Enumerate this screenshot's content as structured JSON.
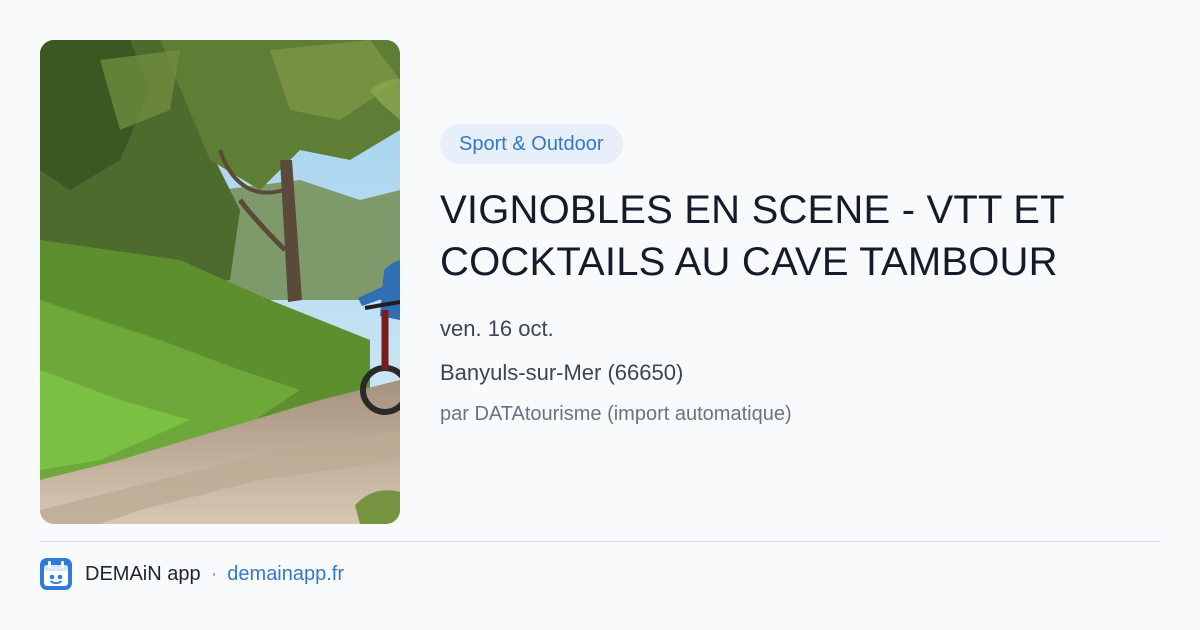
{
  "event": {
    "category": "Sport & Outdoor",
    "title": "VIGNOBLES EN SCENE - VTT ET COCKTAILS AU CAVE TAMBOUR",
    "date": "ven. 16 oct.",
    "location": "Banyuls-sur-Mer (66650)",
    "source": "par DATAtourisme (import automatique)",
    "image": {
      "depicts": "mountain-bike-trail-photo"
    }
  },
  "footer": {
    "app_name": "DEMAiN app",
    "separator": "·",
    "link": "demainapp.fr",
    "logo_icon": "calendar-app-icon"
  },
  "colors": {
    "accent": "#3478c6",
    "tag_bg": "#e6effa",
    "title": "#141b2b",
    "muted": "#6b7380"
  }
}
